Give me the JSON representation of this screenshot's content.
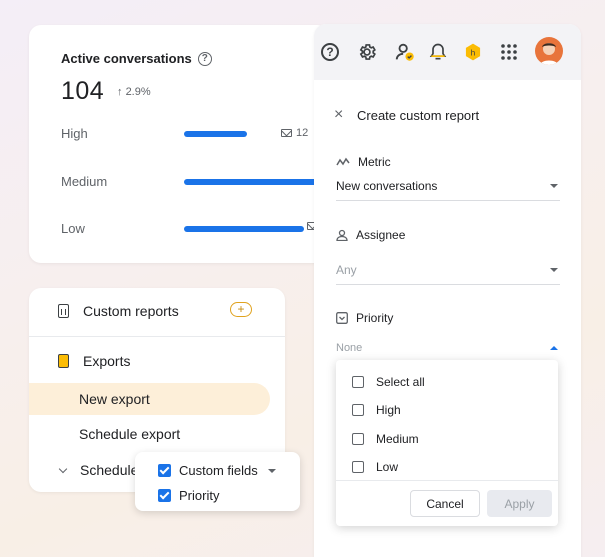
{
  "active": {
    "title": "Active conversations",
    "help_icon": "?",
    "count": "104",
    "trend": "2.9%",
    "rows": [
      {
        "label": "High",
        "count": "12",
        "fill": 0.42
      },
      {
        "label": "Medium",
        "count": "",
        "fill": 1.0
      },
      {
        "label": "Low",
        "count": "",
        "fill": 0.8
      }
    ]
  },
  "nav": {
    "custom_reports": "Custom reports",
    "plus": "+",
    "exports": "Exports",
    "new_export": "New export",
    "schedule_export": "Schedule export",
    "scheduled": "Schedule"
  },
  "fields_popup": {
    "custom_fields": "Custom fields",
    "priority": "Priority"
  },
  "panel": {
    "title": "Create custom report",
    "close": "×",
    "help_icon": "?",
    "avatar_color": "#e8743b",
    "metric_label": "Metric",
    "metric_value": "New conversations",
    "assignee_label": "Assignee",
    "assignee_placeholder": "Any",
    "priority_label": "Priority",
    "priority_placeholder": "None"
  },
  "priority_menu": {
    "options": [
      "Select all",
      "High",
      "Medium",
      "Low"
    ],
    "cancel": "Cancel",
    "apply": "Apply"
  },
  "colors": {
    "accent": "#1a73e8",
    "highlight": "#fdefd9",
    "badge": "#e0a21e"
  }
}
